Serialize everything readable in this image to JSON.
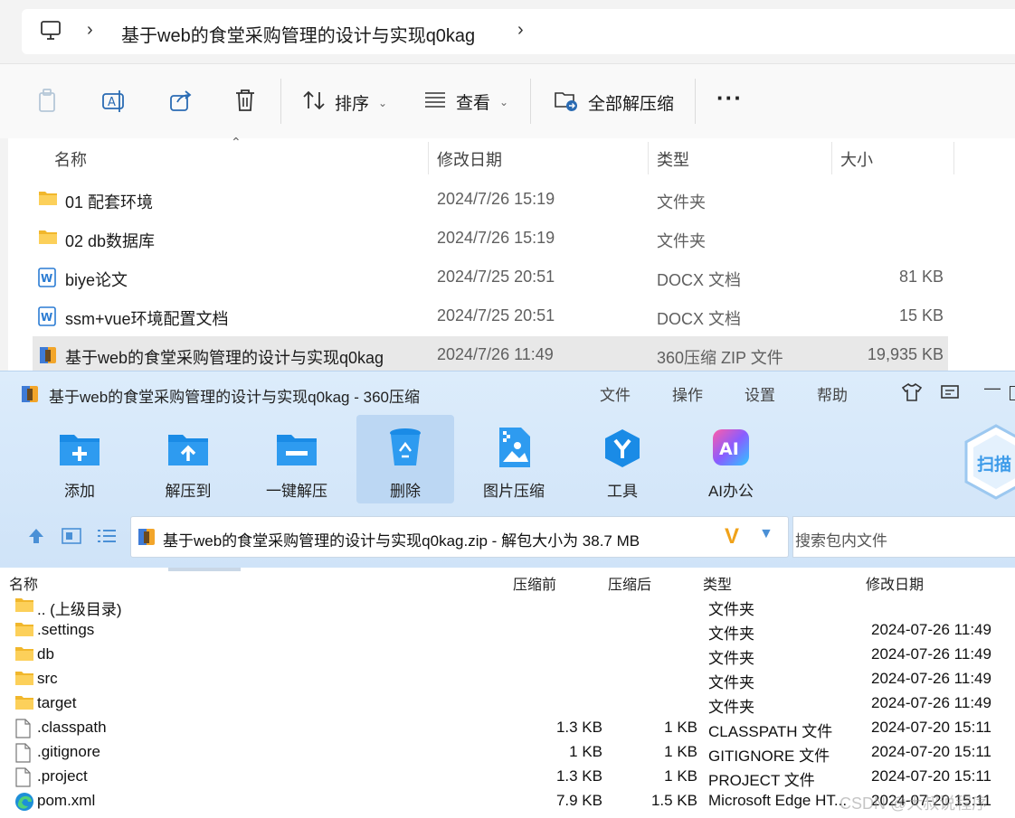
{
  "explorer": {
    "breadcrumb": [
      "基于web的食堂采购管理的设计与实现q0kag"
    ],
    "toolbar": {
      "sort_label": "排序",
      "view_label": "查看",
      "extract_all_label": "全部解压缩"
    },
    "columns": [
      "名称",
      "修改日期",
      "类型",
      "大小"
    ],
    "rows": [
      {
        "name": "01 配套环境",
        "date": "2024/7/26 15:19",
        "type": "文件夹",
        "size": "",
        "icon": "folder-icon"
      },
      {
        "name": "02 db数据库",
        "date": "2024/7/26 15:19",
        "type": "文件夹",
        "size": "",
        "icon": "folder-icon"
      },
      {
        "name": "biye论文",
        "date": "2024/7/25 20:51",
        "type": "DOCX 文档",
        "size": "81 KB",
        "icon": "word-doc-icon"
      },
      {
        "name": "ssm+vue环境配置文档",
        "date": "2024/7/25 20:51",
        "type": "DOCX 文档",
        "size": "15 KB",
        "icon": "word-doc-icon"
      },
      {
        "name": "基于web的食堂采购管理的设计与实现q0kag",
        "date": "2024/7/26 11:49",
        "type": "360压缩 ZIP 文件",
        "size": "19,935 KB",
        "icon": "zip-archive-icon"
      }
    ]
  },
  "zip": {
    "title": "基于web的食堂采购管理的设计与实现q0kag - 360压缩",
    "menu": [
      "文件",
      "操作",
      "设置",
      "帮助"
    ],
    "ribbon": [
      "添加",
      "解压到",
      "一键解压",
      "删除",
      "图片压缩",
      "工具",
      "AI办公"
    ],
    "scan_label": "扫描",
    "path_text": "基于web的食堂采购管理的设计与实现q0kag.zip - 解包大小为 38.7 MB",
    "search_placeholder": "搜索包内文件",
    "columns": [
      "名称",
      "压缩前",
      "压缩后",
      "类型",
      "修改日期"
    ],
    "rows": [
      {
        "name": ".. (上级目录)",
        "before": "",
        "after": "",
        "type": "文件夹",
        "date": "",
        "icon": "folder-icon"
      },
      {
        "name": ".settings",
        "before": "",
        "after": "",
        "type": "文件夹",
        "date": "2024-07-26 11:49",
        "icon": "folder-icon"
      },
      {
        "name": "db",
        "before": "",
        "after": "",
        "type": "文件夹",
        "date": "2024-07-26 11:49",
        "icon": "folder-icon"
      },
      {
        "name": "src",
        "before": "",
        "after": "",
        "type": "文件夹",
        "date": "2024-07-26 11:49",
        "icon": "folder-icon"
      },
      {
        "name": "target",
        "before": "",
        "after": "",
        "type": "文件夹",
        "date": "2024-07-26 11:49",
        "icon": "folder-icon"
      },
      {
        "name": ".classpath",
        "before": "1.3 KB",
        "after": "1 KB",
        "type": "CLASSPATH 文件",
        "date": "2024-07-20 15:11",
        "icon": "file-icon"
      },
      {
        "name": ".gitignore",
        "before": "1 KB",
        "after": "1 KB",
        "type": "GITIGNORE 文件",
        "date": "2024-07-20 15:11",
        "icon": "file-icon"
      },
      {
        "name": ".project",
        "before": "1.3 KB",
        "after": "1 KB",
        "type": "PROJECT 文件",
        "date": "2024-07-20 15:11",
        "icon": "file-icon"
      },
      {
        "name": "pom.xml",
        "before": "7.9 KB",
        "after": "1.5 KB",
        "type": "Microsoft Edge HT...",
        "date": "2024-07-20 15:11",
        "icon": "edge-icon"
      }
    ]
  },
  "watermark": "CSDN @大叔说程序"
}
